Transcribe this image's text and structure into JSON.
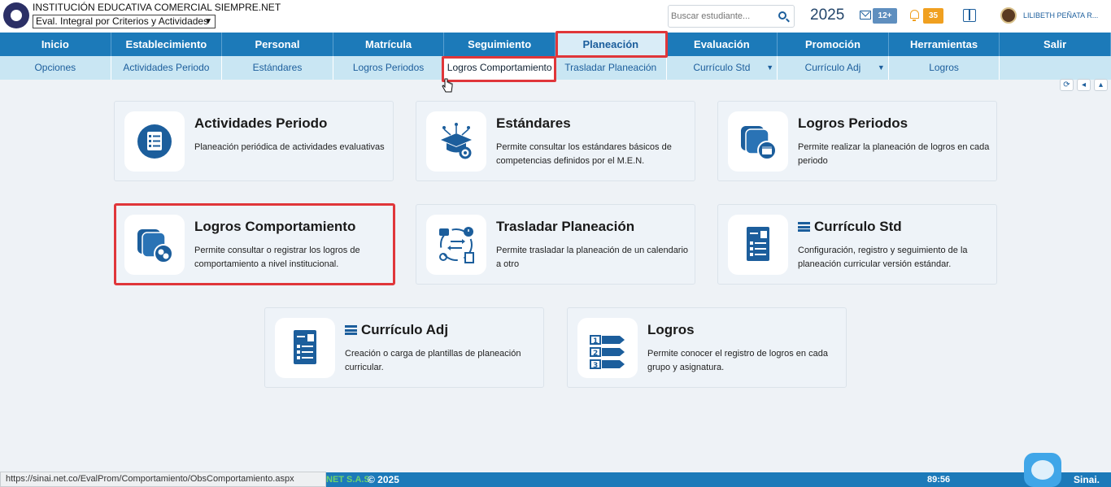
{
  "header": {
    "institution": "INSTITUCIÓN EDUCATIVA COMERCIAL SIEMPRE.NET",
    "evaluation_mode": "Eval. Integral por Criterios y Actividades",
    "search_placeholder": "Buscar estudiante...",
    "year": "2025",
    "messages_badge": "12+",
    "alerts_badge": "35",
    "user_name": "LILIBETH PEÑATA R..."
  },
  "main_nav": [
    {
      "label": "Inicio"
    },
    {
      "label": "Establecimiento"
    },
    {
      "label": "Personal"
    },
    {
      "label": "Matrícula"
    },
    {
      "label": "Seguimiento"
    },
    {
      "label": "Planeación"
    },
    {
      "label": "Evaluación"
    },
    {
      "label": "Promoción"
    },
    {
      "label": "Herramientas"
    },
    {
      "label": "Salir"
    }
  ],
  "sub_nav": [
    {
      "label": "Opciones"
    },
    {
      "label": "Actividades Periodo"
    },
    {
      "label": "Estándares"
    },
    {
      "label": "Logros Periodos"
    },
    {
      "label": "Logros Comportamiento"
    },
    {
      "label": "Trasladar Planeación"
    },
    {
      "label": "Currículo Std",
      "dropdown": "▼"
    },
    {
      "label": "Currículo Adj",
      "dropdown": "▼"
    },
    {
      "label": "Logros"
    }
  ],
  "cards": [
    {
      "title": "Actividades Periodo",
      "desc": "Planeación periódica de actividades evaluativas"
    },
    {
      "title": "Estándares",
      "desc": "Permite consultar los estándares básicos de competencias definidos por el M.E.N."
    },
    {
      "title": "Logros Periodos",
      "desc": "Permite realizar la planeación de logros en cada periodo"
    },
    {
      "title": "Logros Comportamiento",
      "desc": "Permite consultar o registrar los logros de comportamiento a nivel institucional."
    },
    {
      "title": "Trasladar Planeación",
      "desc": "Permite trasladar la planeación de un calendario a otro"
    },
    {
      "title": "Currículo Std",
      "desc": "Configuración, registro y seguimiento de la planeación curricular versión estándar."
    },
    {
      "title": "Currículo Adj",
      "desc": "Creación o carga de plantillas de planeación curricular."
    },
    {
      "title": "Logros",
      "desc": "Permite conocer el registro de logros en cada grupo y asignatura."
    }
  ],
  "footer": {
    "status_url": "https://sinai.net.co/EvalProm/Comportamiento/ObsComportamiento.aspx",
    "brand": "NET S.A.S",
    "copyright": "© 2025",
    "timer": "89:56",
    "logo_text": "Sinai."
  },
  "colors": {
    "nav_blue": "#1c7ab9",
    "subnav_bg": "#c9e6f3",
    "highlight_red": "#e0363a",
    "icon_blue": "#1c5e9c"
  },
  "icons": {
    "refresh": "refresh-icon",
    "back": "back-icon",
    "up": "up-icon"
  }
}
